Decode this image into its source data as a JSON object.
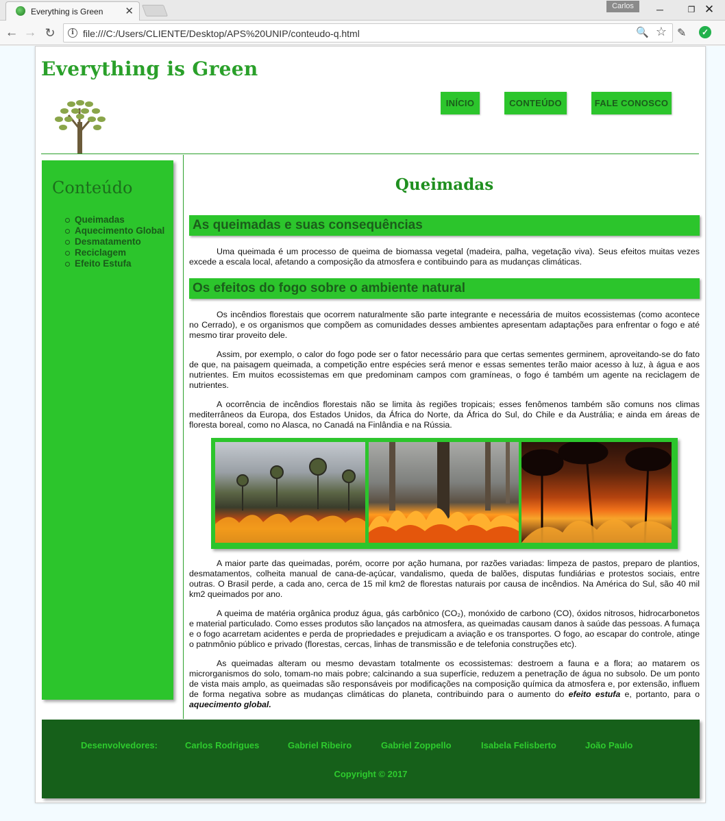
{
  "browser": {
    "tab_title": "Everything is Green",
    "profile_name": "Carlos",
    "url": "file:///C:/Users/CLIENTE/Desktop/APS%20UNIP/conteudo-q.html",
    "icons": {
      "close": "✕",
      "back": "←",
      "forward": "→",
      "reload": "↻",
      "info": "i",
      "zoom": "🔍",
      "star": "☆",
      "minimize": "─",
      "maximize": "❐",
      "window_close": "✕",
      "dropper": "✎",
      "check": "✓"
    }
  },
  "site": {
    "title": "Everything is Green",
    "nav": [
      "INÍCIO",
      "CONTEÚDO",
      "FALE CONOSCO"
    ],
    "accent_color": "#2cc52c",
    "footer_color": "#16601a"
  },
  "sidebar": {
    "title": "Conteúdo",
    "items": [
      "Queimadas",
      "Aquecimento Global",
      "Desmatamento",
      "Reciclagem",
      "Efeito Estufa"
    ]
  },
  "main": {
    "heading": "Queimadas",
    "section1_title": "As queimadas e suas consequências",
    "section2_title": "Os efeitos do fogo sobre o ambiente natural",
    "paragraphs": [
      "Uma queimada é um processo de queima de biomassa vegetal (madeira, palha, vegetação viva). Seus efeitos muitas vezes excede a escala local, afetando a composição da atmosfera e contibuindo para as mudanças climáticas.",
      "Os incêndios florestais que ocorrem naturalmente são parte integrante e necessária de muitos ecossistemas (como acontece no Cerrado), e os organismos que compõem as comunidades desses ambientes apresentam adaptações para enfrentar o fogo e até mesmo tirar proveito dele.",
      "Assim, por exemplo, o calor do fogo pode ser o fator necessário para que certas sementes germinem, aproveitando-se do fato de que, na paisagem queimada, a competição entre espécies será menor e essas sementes terão maior acesso à luz, à água e aos nutrientes. Em muitos ecossistemas em que predominam campos com gramíneas, o fogo é também um agente na reciclagem de nutrientes.",
      "A ocorrência de incêndios florestais não se limita às regiões tropicais; esses fenômenos também são comuns nos climas mediterrâneos da Europa, dos Estados Unidos, da África do Norte, da África do Sul, do Chile e da Austrália; e ainda em áreas de floresta boreal, como no Alasca, no Canadá na Finlândia e na Rússia.",
      "A maior parte das queimadas, porém, ocorre por ação humana, por razões variadas: limpeza de pastos, preparo de plantios, desmatamentos, colheita manual de cana-de-açúcar, vandalismo, queda de balões, disputas fundiárias e protestos sociais, entre outras. O Brasil perde, a cada ano, cerca de 15 mil km2 de florestas naturais por causa de incêndios. Na América do Sul, são 40 mil km2 queimados por ano.",
      "A queima de matéria orgânica produz água, gás carbônico (CO₂), monóxido de carbono (CO), óxidos nitrosos, hidrocarbonetos e material particulado. Como esses produtos são lançados na atmosfera, as queimadas causam danos à saúde das pessoas. A fumaça e o fogo acarretam acidentes e perda de propriedades e prejudicam a aviação e os transportes. O fogo, ao escapar do controle, atinge o patnmônio público e privado (florestas, cercas, linhas de transmissão e de telefonia construções etc).",
      "As queimadas alteram ou mesmo devastam totalmente os ecossistemas: destroem a fauna e a flora; ao matarem os microrganismos do solo, tomam-no mais pobre; calcinando a sua superfície, reduzem a penetração de água no subsolo. De um ponto de vista mais amplo, as queimadas são responsáveis por modificações na composição química da atmosfera e, por extensão, influem de forma negativa sobre as mudanças climáticas do planeta, contribuindo para o aumento do"
    ],
    "p6_em1": "efeito estufa",
    "p6_mid": " e, portanto, para o ",
    "p6_em2": "aquecimento global."
  },
  "footer": {
    "devs_label": "Desenvolvedores:",
    "devs": [
      "Carlos Rodrigues",
      "Gabriel Ribeiro",
      "Gabriel Zoppello",
      "Isabela Felisberto",
      "João Paulo"
    ],
    "copyright": "Copyright © 2017"
  }
}
